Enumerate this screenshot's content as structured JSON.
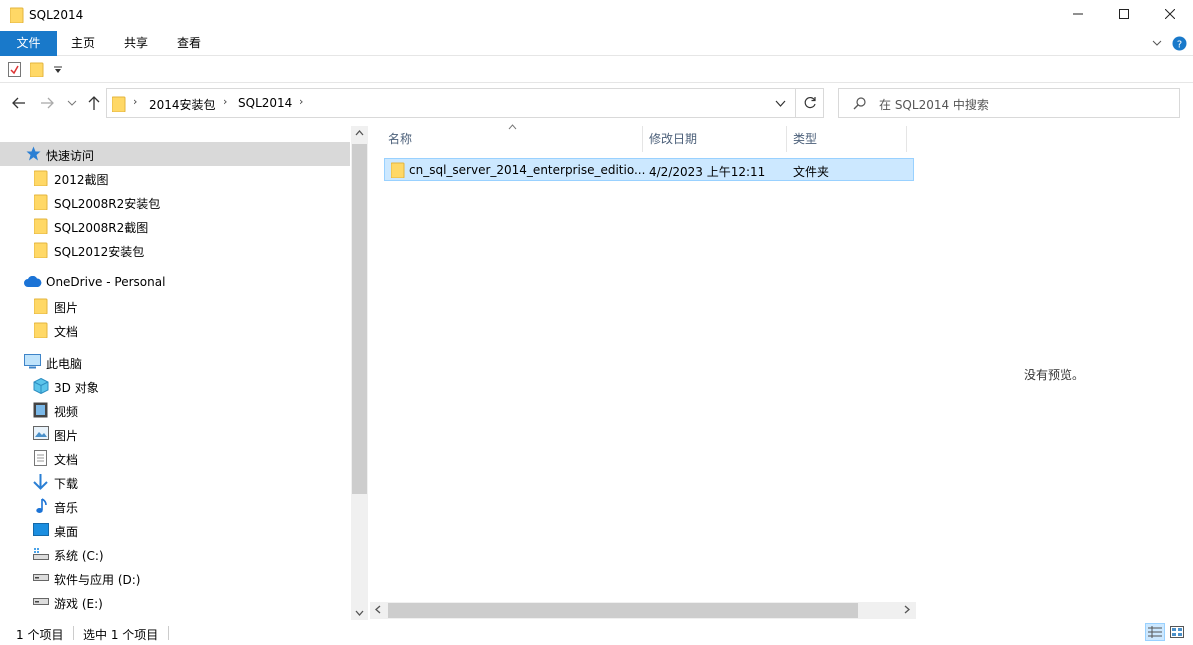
{
  "window": {
    "title": "SQL2014"
  },
  "ribbon": {
    "tabs": [
      "文件",
      "主页",
      "共享",
      "查看"
    ]
  },
  "address": {
    "crumbs": [
      "2014安装包",
      "SQL2014"
    ]
  },
  "search": {
    "placeholder": "在 SQL2014 中搜索"
  },
  "nav": {
    "quick_access": "快速访问",
    "quick_items": [
      "2012截图",
      "SQL2008R2安装包",
      "SQL2008R2截图",
      "SQL2012安装包"
    ],
    "onedrive": "OneDrive - Personal",
    "onedrive_items": [
      "图片",
      "文档"
    ],
    "this_pc": "此电脑",
    "pc_items": [
      "3D 对象",
      "视频",
      "图片",
      "文档",
      "下载",
      "音乐",
      "桌面",
      "系统 (C:)",
      "软件与应用 (D:)",
      "游戏 (E:)"
    ]
  },
  "columns": {
    "name": "名称",
    "date": "修改日期",
    "type": "类型"
  },
  "files": [
    {
      "name": "cn_sql_server_2014_enterprise_editio...",
      "date": "4/2/2023 上午12:11",
      "type": "文件夹"
    }
  ],
  "preview": {
    "text": "没有预览。"
  },
  "status": {
    "count": "1 个项目",
    "selected": "选中 1 个项目"
  },
  "colors": {
    "accent": "#1979ca",
    "selection": "#cce8ff",
    "folder": "#ffd866"
  }
}
